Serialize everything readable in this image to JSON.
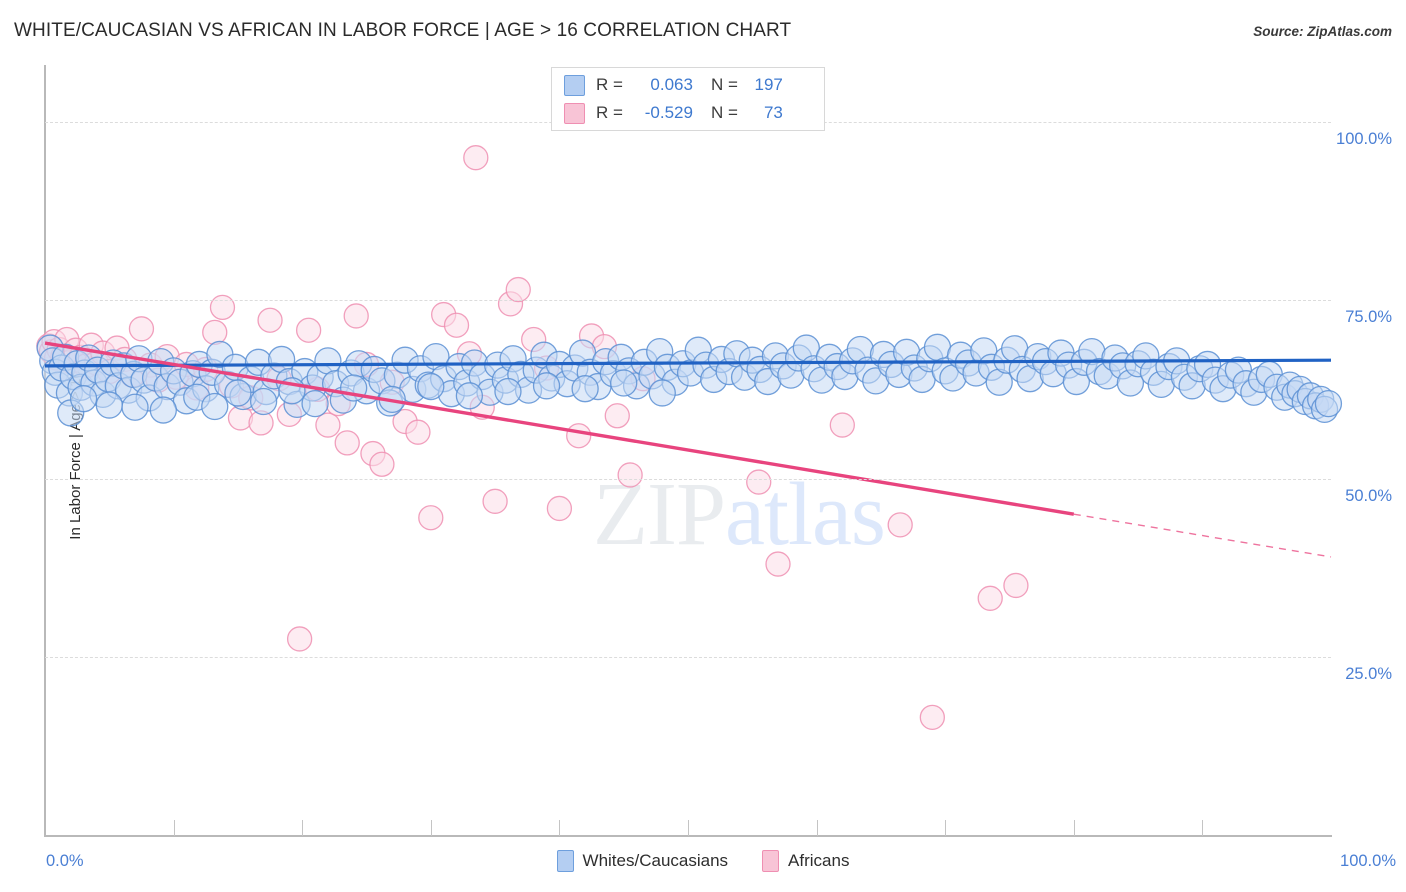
{
  "header": {
    "title": "WHITE/CAUCASIAN VS AFRICAN IN LABOR FORCE | AGE > 16 CORRELATION CHART",
    "source": "Source: ZipAtlas.com"
  },
  "watermark": {
    "part1": "ZIP",
    "part2": "atlas"
  },
  "stats": {
    "rows": [
      {
        "r_label": "R =",
        "r_value": "0.063",
        "n_label": "N =",
        "n_value": "197",
        "color": "#b4cef2"
      },
      {
        "r_label": "R =",
        "r_value": "-0.529",
        "n_label": "N =",
        "n_value": "73",
        "color": "#f8c4d6"
      }
    ]
  },
  "axes": {
    "y_title": "In Labor Force | Age > 16",
    "y_ticks": [
      "100.0%",
      "75.0%",
      "50.0%",
      "25.0%"
    ],
    "x_min": "0.0%",
    "x_max": "100.0%"
  },
  "legend": {
    "items": [
      {
        "label": "Whites/Caucasians",
        "color": "#b4cef2"
      },
      {
        "label": "Africans",
        "color": "#f8c4d6"
      }
    ]
  },
  "chart_data": {
    "type": "scatter",
    "title": "WHITE/CAUCASIAN VS AFRICAN IN LABOR FORCE | AGE > 16 CORRELATION CHART",
    "xlabel": "",
    "ylabel": "In Labor Force | Age > 16",
    "xlim": [
      0,
      100
    ],
    "ylim": [
      0,
      108
    ],
    "grid": true,
    "x_ticks": [
      0,
      100
    ],
    "y_ticks": [
      25,
      50,
      75,
      100
    ],
    "legend_position": "bottom-center",
    "colors": {
      "blue_fill": "#c5d9f4",
      "blue_stroke": "#5b8fd4",
      "pink_fill": "#fbdde8",
      "pink_stroke": "#ef8fb2",
      "blue_line": "#2062c4",
      "pink_line": "#e8447e",
      "tick_label": "#4a7fd4"
    },
    "series": [
      {
        "name": "Whites/Caucasians",
        "color": "#c5d9f4",
        "r": 0.063,
        "n": 197,
        "trend": {
          "x0": 0,
          "y0": 65.8,
          "x1": 100,
          "y1": 66.6,
          "dash_from": 100
        },
        "points": [
          [
            0.4,
            68.3
          ],
          [
            0.6,
            66.5
          ],
          [
            0.8,
            64.9
          ],
          [
            1.0,
            63.1
          ],
          [
            1.3,
            65.5
          ],
          [
            1.6,
            67.0
          ],
          [
            1.9,
            62.0
          ],
          [
            2.2,
            64.3
          ],
          [
            2.5,
            66.1
          ],
          [
            2.8,
            62.8
          ],
          [
            3.1,
            64.8
          ],
          [
            3.4,
            66.9
          ],
          [
            3.8,
            63.4
          ],
          [
            4.1,
            65.2
          ],
          [
            4.5,
            61.8
          ],
          [
            4.9,
            64.0
          ],
          [
            5.3,
            66.2
          ],
          [
            5.7,
            63.0
          ],
          [
            6.1,
            65.8
          ],
          [
            6.5,
            62.4
          ],
          [
            6.9,
            64.6
          ],
          [
            7.3,
            66.8
          ],
          [
            7.7,
            63.8
          ],
          [
            8.1,
            61.3
          ],
          [
            8.6,
            64.1
          ],
          [
            9.0,
            66.4
          ],
          [
            9.5,
            62.9
          ],
          [
            10.0,
            65.1
          ],
          [
            10.5,
            63.5
          ],
          [
            11.0,
            60.9
          ],
          [
            11.5,
            64.7
          ],
          [
            12.0,
            66.0
          ],
          [
            12.5,
            62.6
          ],
          [
            13.0,
            64.9
          ],
          [
            13.6,
            67.4
          ],
          [
            14.2,
            63.2
          ],
          [
            14.8,
            65.6
          ],
          [
            15.4,
            61.5
          ],
          [
            16.0,
            63.9
          ],
          [
            16.6,
            66.3
          ],
          [
            17.2,
            62.2
          ],
          [
            17.8,
            64.4
          ],
          [
            18.4,
            66.7
          ],
          [
            19.0,
            63.6
          ],
          [
            19.6,
            60.4
          ],
          [
            20.2,
            65.0
          ],
          [
            20.8,
            62.7
          ],
          [
            21.4,
            64.2
          ],
          [
            22.0,
            66.5
          ],
          [
            22.6,
            63.3
          ],
          [
            23.2,
            61.0
          ],
          [
            23.8,
            64.8
          ],
          [
            24.4,
            66.1
          ],
          [
            25.0,
            62.3
          ],
          [
            25.6,
            65.3
          ],
          [
            26.2,
            63.7
          ],
          [
            26.8,
            60.6
          ],
          [
            27.4,
            64.5
          ],
          [
            28.0,
            66.6
          ],
          [
            28.6,
            62.5
          ],
          [
            29.2,
            65.4
          ],
          [
            29.8,
            63.1
          ],
          [
            30.4,
            67.1
          ],
          [
            31.0,
            64.0
          ],
          [
            31.6,
            61.9
          ],
          [
            32.2,
            65.7
          ],
          [
            32.8,
            63.4
          ],
          [
            33.4,
            66.2
          ],
          [
            34.0,
            64.3
          ],
          [
            34.6,
            62.1
          ],
          [
            35.2,
            65.9
          ],
          [
            35.8,
            63.8
          ],
          [
            36.4,
            66.8
          ],
          [
            37.0,
            64.6
          ],
          [
            37.6,
            62.4
          ],
          [
            38.2,
            65.2
          ],
          [
            38.8,
            67.3
          ],
          [
            39.4,
            64.1
          ],
          [
            40.0,
            66.0
          ],
          [
            40.6,
            63.3
          ],
          [
            41.2,
            65.5
          ],
          [
            41.8,
            67.6
          ],
          [
            42.4,
            64.9
          ],
          [
            43.0,
            62.9
          ],
          [
            43.6,
            66.4
          ],
          [
            44.2,
            64.7
          ],
          [
            44.8,
            67.0
          ],
          [
            45.4,
            65.1
          ],
          [
            46.0,
            63.0
          ],
          [
            46.6,
            66.3
          ],
          [
            47.2,
            64.4
          ],
          [
            47.8,
            67.8
          ],
          [
            48.4,
            65.6
          ],
          [
            49.0,
            63.5
          ],
          [
            49.6,
            66.1
          ],
          [
            50.2,
            64.8
          ],
          [
            50.8,
            68.0
          ],
          [
            51.4,
            65.9
          ],
          [
            52.0,
            63.9
          ],
          [
            52.6,
            66.7
          ],
          [
            53.2,
            65.0
          ],
          [
            53.8,
            67.5
          ],
          [
            54.4,
            64.2
          ],
          [
            55.0,
            66.6
          ],
          [
            55.6,
            65.3
          ],
          [
            56.2,
            63.6
          ],
          [
            56.8,
            67.2
          ],
          [
            57.4,
            65.8
          ],
          [
            58.0,
            64.5
          ],
          [
            58.6,
            66.9
          ],
          [
            59.2,
            68.3
          ],
          [
            59.8,
            65.4
          ],
          [
            60.4,
            63.8
          ],
          [
            61.0,
            67.0
          ],
          [
            61.6,
            65.7
          ],
          [
            62.2,
            64.3
          ],
          [
            62.8,
            66.5
          ],
          [
            63.4,
            68.1
          ],
          [
            64.0,
            65.2
          ],
          [
            64.6,
            63.7
          ],
          [
            65.2,
            67.4
          ],
          [
            65.8,
            66.0
          ],
          [
            66.4,
            64.6
          ],
          [
            67.0,
            67.7
          ],
          [
            67.6,
            65.5
          ],
          [
            68.2,
            63.9
          ],
          [
            68.8,
            66.8
          ],
          [
            69.4,
            68.4
          ],
          [
            70.0,
            65.1
          ],
          [
            70.6,
            64.1
          ],
          [
            71.2,
            67.3
          ],
          [
            71.8,
            66.2
          ],
          [
            72.4,
            64.8
          ],
          [
            73.0,
            67.9
          ],
          [
            73.6,
            65.6
          ],
          [
            74.2,
            63.5
          ],
          [
            74.8,
            66.6
          ],
          [
            75.4,
            68.2
          ],
          [
            76.0,
            65.3
          ],
          [
            76.6,
            64.0
          ],
          [
            77.2,
            67.1
          ],
          [
            77.8,
            66.4
          ],
          [
            78.4,
            64.7
          ],
          [
            79.0,
            67.6
          ],
          [
            79.6,
            65.9
          ],
          [
            80.2,
            63.6
          ],
          [
            80.8,
            66.3
          ],
          [
            81.4,
            67.8
          ],
          [
            82.0,
            65.0
          ],
          [
            82.6,
            64.4
          ],
          [
            83.2,
            66.9
          ],
          [
            83.8,
            65.8
          ],
          [
            84.4,
            63.4
          ],
          [
            85.0,
            66.1
          ],
          [
            85.6,
            67.2
          ],
          [
            86.2,
            64.9
          ],
          [
            86.8,
            63.2
          ],
          [
            87.4,
            65.7
          ],
          [
            88.0,
            66.5
          ],
          [
            88.6,
            64.2
          ],
          [
            89.2,
            63.0
          ],
          [
            89.8,
            65.4
          ],
          [
            90.4,
            66.0
          ],
          [
            91.0,
            63.8
          ],
          [
            91.6,
            62.6
          ],
          [
            92.2,
            64.5
          ],
          [
            92.8,
            65.2
          ],
          [
            93.4,
            63.3
          ],
          [
            94.0,
            62.1
          ],
          [
            94.6,
            63.9
          ],
          [
            95.2,
            64.6
          ],
          [
            95.8,
            62.8
          ],
          [
            96.4,
            61.4
          ],
          [
            96.8,
            63.1
          ],
          [
            97.2,
            61.9
          ],
          [
            97.6,
            62.5
          ],
          [
            98.0,
            60.8
          ],
          [
            98.4,
            61.6
          ],
          [
            98.8,
            60.2
          ],
          [
            99.2,
            61.1
          ],
          [
            99.5,
            59.7
          ],
          [
            99.8,
            60.5
          ],
          [
            2.0,
            59.2
          ],
          [
            3.0,
            61.2
          ],
          [
            5.0,
            60.3
          ],
          [
            7.0,
            60.0
          ],
          [
            9.2,
            59.6
          ],
          [
            11.8,
            61.4
          ],
          [
            13.2,
            60.1
          ],
          [
            15.0,
            62.0
          ],
          [
            17.0,
            60.8
          ],
          [
            19.2,
            62.3
          ],
          [
            21.0,
            60.5
          ],
          [
            24.0,
            62.7
          ],
          [
            27.0,
            61.1
          ],
          [
            30.0,
            62.9
          ],
          [
            33.0,
            61.6
          ],
          [
            36.0,
            62.2
          ],
          [
            39.0,
            63.0
          ],
          [
            42.0,
            62.6
          ],
          [
            45.0,
            63.4
          ],
          [
            48.0,
            62.0
          ]
        ]
      },
      {
        "name": "Africans",
        "color": "#fbdde8",
        "r": -0.529,
        "n": 73,
        "trend": {
          "x0": 0,
          "y0": 69.0,
          "x1": 100,
          "y1": 39.0,
          "dash_from": 80
        },
        "points": [
          [
            0.3,
            68.6
          ],
          [
            0.5,
            67.8
          ],
          [
            0.7,
            69.2
          ],
          [
            0.9,
            66.9
          ],
          [
            1.1,
            68.1
          ],
          [
            1.4,
            67.2
          ],
          [
            1.7,
            69.5
          ],
          [
            2.0,
            66.4
          ],
          [
            2.4,
            68.0
          ],
          [
            2.8,
            67.0
          ],
          [
            3.2,
            65.8
          ],
          [
            3.6,
            68.7
          ],
          [
            4.0,
            66.2
          ],
          [
            4.5,
            67.6
          ],
          [
            5.0,
            65.0
          ],
          [
            5.6,
            68.3
          ],
          [
            6.2,
            66.7
          ],
          [
            6.8,
            64.5
          ],
          [
            7.5,
            71.0
          ],
          [
            8.2,
            65.9
          ],
          [
            8.8,
            63.8
          ],
          [
            9.5,
            67.1
          ],
          [
            10.2,
            64.2
          ],
          [
            11.0,
            66.0
          ],
          [
            11.8,
            62.7
          ],
          [
            12.5,
            65.3
          ],
          [
            13.2,
            70.5
          ],
          [
            13.8,
            74.0
          ],
          [
            14.5,
            63.0
          ],
          [
            15.2,
            58.5
          ],
          [
            16.0,
            61.3
          ],
          [
            16.8,
            57.8
          ],
          [
            17.5,
            72.2
          ],
          [
            18.2,
            64.0
          ],
          [
            19.0,
            59.0
          ],
          [
            19.8,
            27.5
          ],
          [
            20.5,
            70.8
          ],
          [
            21.2,
            62.5
          ],
          [
            22.0,
            57.5
          ],
          [
            22.8,
            60.5
          ],
          [
            23.5,
            55.0
          ],
          [
            24.2,
            72.8
          ],
          [
            25.0,
            66.0
          ],
          [
            25.5,
            53.5
          ],
          [
            26.2,
            52.0
          ],
          [
            27.0,
            63.5
          ],
          [
            28.0,
            58.0
          ],
          [
            29.0,
            56.5
          ],
          [
            30.0,
            44.5
          ],
          [
            31.0,
            73.0
          ],
          [
            32.0,
            71.5
          ],
          [
            33.0,
            67.5
          ],
          [
            34.0,
            60.0
          ],
          [
            35.0,
            46.8
          ],
          [
            36.2,
            74.5
          ],
          [
            36.8,
            76.5
          ],
          [
            33.5,
            95.0
          ],
          [
            38.0,
            69.5
          ],
          [
            39.0,
            65.5
          ],
          [
            40.0,
            45.8
          ],
          [
            41.5,
            56.0
          ],
          [
            42.5,
            70.0
          ],
          [
            43.5,
            68.5
          ],
          [
            44.5,
            58.8
          ],
          [
            45.5,
            50.5
          ],
          [
            46.5,
            64.0
          ],
          [
            55.5,
            49.5
          ],
          [
            57.0,
            38.0
          ],
          [
            62.0,
            57.5
          ],
          [
            66.5,
            43.5
          ],
          [
            73.5,
            33.2
          ],
          [
            75.5,
            35.0
          ],
          [
            69.0,
            16.5
          ]
        ]
      }
    ]
  }
}
